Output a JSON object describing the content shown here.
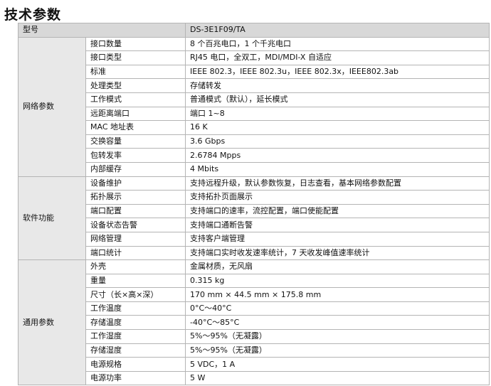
{
  "title": "技术参数",
  "header": {
    "label": "型号",
    "model": "DS-3E1F09/TA"
  },
  "groups": [
    {
      "name": "网络参数",
      "rows": [
        {
          "param": "接口数量",
          "value": "8 个百兆电口，1 个千兆电口"
        },
        {
          "param": "接口类型",
          "value": "RJ45 电口，全双工，MDI/MDI-X 自适应"
        },
        {
          "param": "标准",
          "value": "IEEE 802.3，IEEE 802.3u，IEEE 802.3x，IEEE802.3ab"
        },
        {
          "param": "处理类型",
          "value": "存储转发"
        },
        {
          "param": "工作模式",
          "value": "普通模式（默认），延长模式"
        },
        {
          "param": "远距离端口",
          "value": "端口 1~8"
        },
        {
          "param": "MAC 地址表",
          "value": "16 K"
        },
        {
          "param": "交换容量",
          "value": "3.6 Gbps"
        },
        {
          "param": "包转发率",
          "value": "2.6784 Mpps"
        },
        {
          "param": "内部缓存",
          "value": "4 Mbits"
        }
      ]
    },
    {
      "name": "软件功能",
      "rows": [
        {
          "param": "设备维护",
          "value": "支持远程升级，默认参数恢复，日志查看，基本网络参数配置"
        },
        {
          "param": "拓扑展示",
          "value": "支持拓扑页面展示"
        },
        {
          "param": "端口配置",
          "value": "支持端口的速率，流控配置，端口使能配置"
        },
        {
          "param": "设备状态告警",
          "value": "支持端口通断告警"
        },
        {
          "param": "网络管理",
          "value": "支持客户端管理"
        },
        {
          "param": "端口统计",
          "value": "支持端口实时收发速率统计，7 天收发峰值速率统计"
        }
      ]
    },
    {
      "name": "通用参数",
      "rows": [
        {
          "param": "外壳",
          "value": "金属材质，无风扇"
        },
        {
          "param": "重量",
          "value": "0.315 kg"
        },
        {
          "param": "尺寸（长×高×深）",
          "value": "170 mm × 44.5 mm × 175.8 mm"
        },
        {
          "param": "工作温度",
          "value": "0°C～40°C"
        },
        {
          "param": "存储温度",
          "value": "-40°C～85°C"
        },
        {
          "param": "工作湿度",
          "value": "5%～95%（无凝露）"
        },
        {
          "param": "存储湿度",
          "value": "5%～95%（无凝露）"
        },
        {
          "param": "电源规格",
          "value": "5 VDC，1 A"
        },
        {
          "param": "电源功率",
          "value": "5 W"
        }
      ]
    }
  ]
}
